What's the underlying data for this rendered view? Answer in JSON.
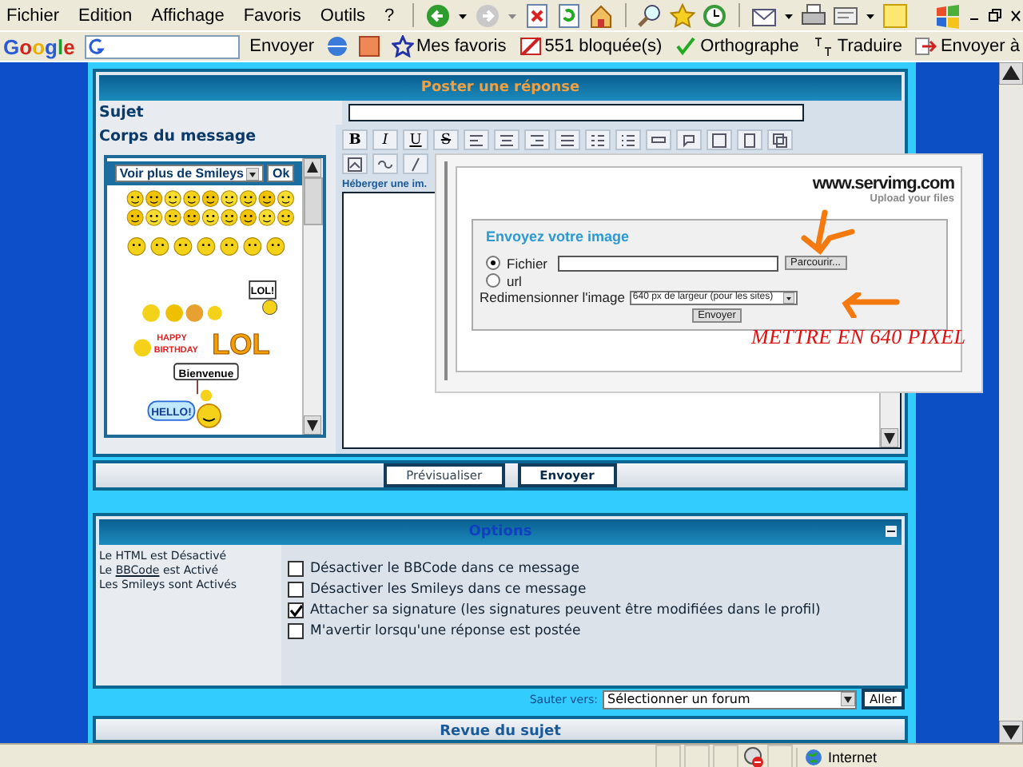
{
  "menu": [
    "Fichier",
    "Edition",
    "Affichage",
    "Favoris",
    "Outils",
    "?"
  ],
  "google_bar": {
    "logo": "Google",
    "send": "Envoyer",
    "favorites": "Mes favoris",
    "blocked": "551 bloquée(s)",
    "spelling": "Orthographe",
    "translate": "Traduire",
    "send_to": "Envoyer à"
  },
  "post": {
    "title": "Poster une réponse",
    "subject_label": "Sujet",
    "body_label": "Corps du message",
    "smileys_select": "Voir plus de Smileys",
    "smileys_ok": "Ok",
    "smiley_captions": [
      "LOL!",
      "HAPPY",
      "BIRTHDAY",
      "LOL",
      "Bienvenue",
      "HELLO!"
    ],
    "format_buttons": [
      "B",
      "I",
      "U",
      "S"
    ],
    "host_link": "Héberger une im.",
    "preview": "Prévisualiser",
    "send": "Envoyer"
  },
  "upload": {
    "logo": "www.servimg.com",
    "tagline": "Upload your files",
    "heading": "Envoyez votre image",
    "sources": [
      {
        "label": "Fichier",
        "selected": true
      },
      {
        "label": "url",
        "selected": false
      }
    ],
    "browse": "Parcourir...",
    "resize_label": "Redimensionner l'image",
    "resize_value": "640 px de largeur (pour les sites)",
    "send": "Envoyer",
    "annotation": "METTRE EN 640 PIXEL"
  },
  "options": {
    "title": "Options",
    "html_status": "Le HTML est Désactivé",
    "bbcode_prefix": "Le",
    "bbcode_link": "BBCode",
    "bbcode_suffix": "est Activé",
    "smileys_status": "Les Smileys sont Activés",
    "checkboxes": [
      {
        "label": "Désactiver le BBCode dans ce message",
        "checked": false
      },
      {
        "label": "Désactiver les Smileys dans ce message",
        "checked": false
      },
      {
        "label": "Attacher sa signature (les signatures peuvent être modifiées dans le profil)",
        "checked": true
      },
      {
        "label": "M'avertir lorsqu'une réponse est postée",
        "checked": false
      }
    ]
  },
  "jump": {
    "label": "Sauter vers:",
    "value": "Sélectionner un forum",
    "go": "Aller"
  },
  "review": {
    "title": "Revue du sujet"
  },
  "status_bar": {
    "zone": "Internet"
  }
}
